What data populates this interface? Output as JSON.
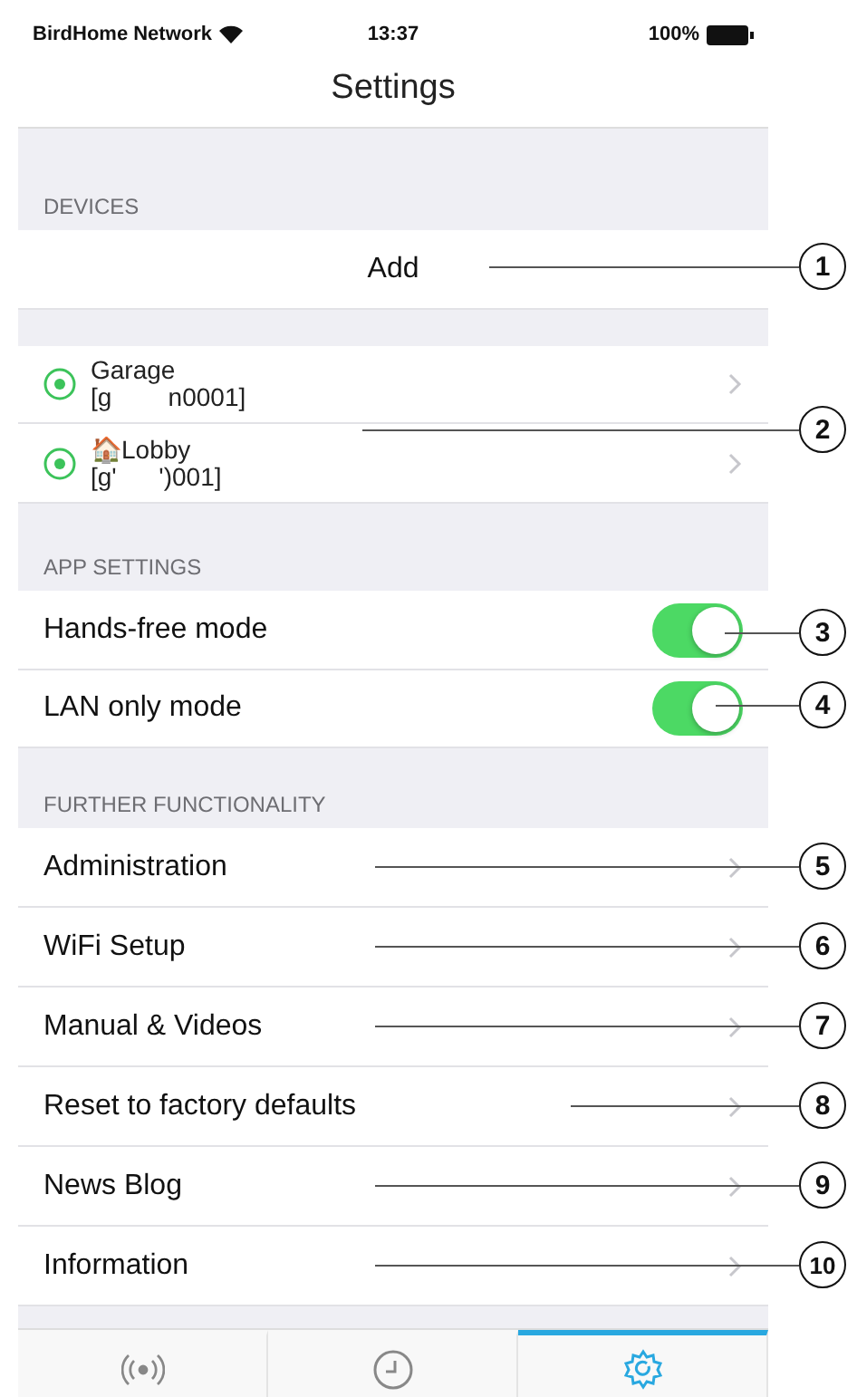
{
  "status_bar": {
    "carrier": "BirdHome Network",
    "time": "13:37",
    "battery": "100%"
  },
  "title": "Settings",
  "devices_header": "DEVICES",
  "add": {
    "label": "Add",
    "callout": "1"
  },
  "devices": {
    "callout": "2",
    "items": [
      {
        "name": "Garage",
        "id": "[g        n0001]"
      },
      {
        "name": "🏠Lobby",
        "id": "[g'      ')001]"
      }
    ]
  },
  "app_settings": {
    "header": "APP SETTINGS",
    "items": [
      {
        "label": "Hands-free mode",
        "on": true,
        "callout": "3"
      },
      {
        "label": "LAN only mode",
        "on": true,
        "callout": "4"
      }
    ]
  },
  "further": {
    "header": "FURTHER FUNCTIONALITY",
    "items": [
      {
        "label": "Administration",
        "callout": "5"
      },
      {
        "label": "WiFi Setup",
        "callout": "6"
      },
      {
        "label": "Manual & Videos",
        "callout": "7"
      },
      {
        "label": "Reset to factory defaults",
        "callout": "8"
      },
      {
        "label": "News Blog",
        "callout": "9"
      },
      {
        "label": "Information",
        "callout": "10"
      }
    ]
  },
  "tabs": [
    {
      "kind": "broadcast",
      "selected": false
    },
    {
      "kind": "timer",
      "selected": false
    },
    {
      "kind": "settings",
      "selected": true
    }
  ]
}
